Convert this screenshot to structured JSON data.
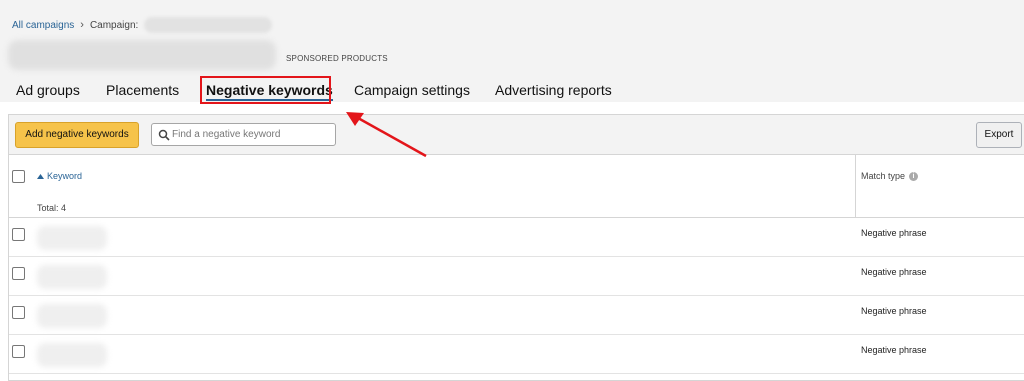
{
  "breadcrumb": {
    "root": "All campaigns",
    "separator": "›",
    "current_label": "Campaign:"
  },
  "campaign": {
    "type_label": "SPONSORED PRODUCTS"
  },
  "tabs": [
    {
      "label": "Ad groups",
      "active": false
    },
    {
      "label": "Placements",
      "active": false
    },
    {
      "label": "Negative keywords",
      "active": true
    },
    {
      "label": "Campaign settings",
      "active": false
    },
    {
      "label": "Advertising reports",
      "active": false
    }
  ],
  "toolbar": {
    "add_label": "Add negative keywords",
    "search_placeholder": "Find a negative keyword",
    "export_label": "Export"
  },
  "table": {
    "keyword_header": "Keyword",
    "total_label": "Total: 4",
    "match_header": "Match type",
    "rows": [
      {
        "match_type": "Negative phrase"
      },
      {
        "match_type": "Negative phrase"
      },
      {
        "match_type": "Negative phrase"
      },
      {
        "match_type": "Negative phrase"
      }
    ]
  },
  "colors": {
    "accent_link": "#2a6496",
    "highlight": "#e3151a",
    "primary_button": "#f6c34a"
  },
  "icons": {
    "search": "search-icon",
    "sort": "sort-up-icon",
    "info": "info-icon",
    "annotation_arrow": "arrow-icon"
  }
}
